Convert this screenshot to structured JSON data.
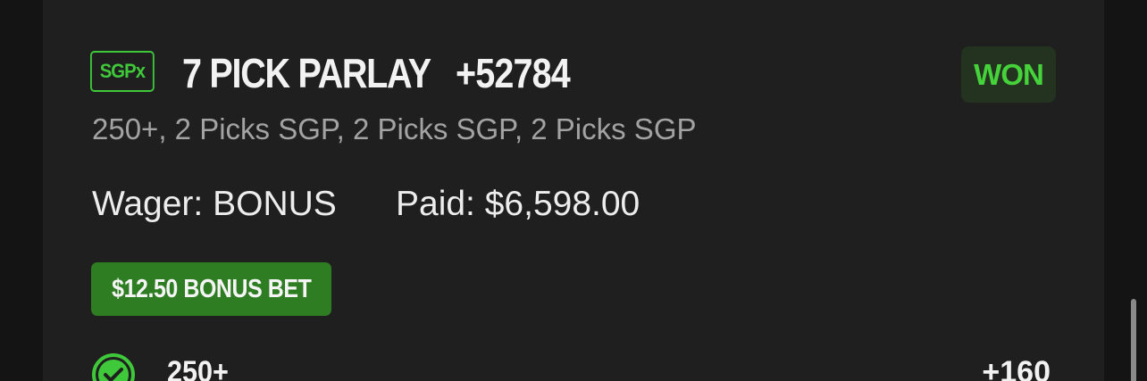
{
  "bet": {
    "badge": "SGPx",
    "title": "7 PICK PARLAY",
    "odds": "+52784",
    "status": "WON",
    "legs_summary": "250+, 2 Picks SGP, 2 Picks SGP, 2 Picks SGP",
    "wager": "Wager: BONUS",
    "paid": "Paid: $6,598.00",
    "bonus_tag": "$12.50 BONUS BET"
  },
  "legs": [
    {
      "label": "250+",
      "odds": "+160",
      "icon": "check-circle-icon"
    }
  ],
  "colors": {
    "accent_green": "#3fc93a",
    "won_bg": "#23331f",
    "bonus_bg": "#2f7d22",
    "card_bg": "#1f1f1f",
    "page_bg": "#141414"
  }
}
